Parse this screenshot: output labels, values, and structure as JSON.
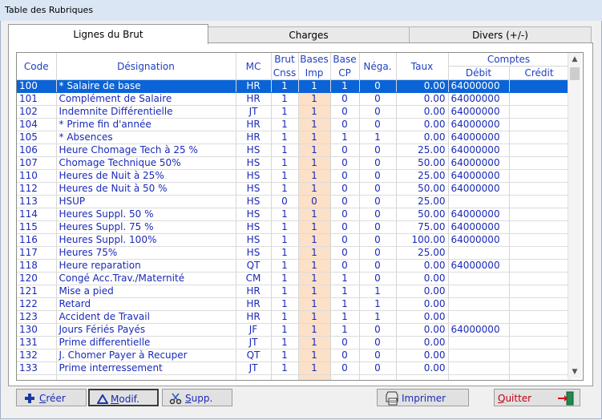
{
  "window": {
    "title": "Table des Rubriques"
  },
  "tabs": [
    {
      "label": "Lignes du Brut",
      "active": true
    },
    {
      "label": "Charges",
      "active": false
    },
    {
      "label": "Divers (+/-)",
      "active": false
    }
  ],
  "grid": {
    "headers": {
      "code": "Code",
      "designation": "Désignation",
      "mc": "MC",
      "brut_top": "Brut",
      "brut_bottom": "Cnss",
      "bases_top": "Bases",
      "bases_bottom": "Imp",
      "base_top": "Base",
      "base_bottom": "CP",
      "nega": "Néga.",
      "taux": "Taux",
      "comptes": "Comptes",
      "debit": "Débit",
      "credit": "Crédit"
    },
    "rows": [
      {
        "code": "100",
        "designation": "* Salaire de base",
        "mc": "HR",
        "brut": "1",
        "imp": "1",
        "cp": "1",
        "nega": "0",
        "taux": "0.00",
        "debit": "64000000",
        "credit": ""
      },
      {
        "code": "101",
        "designation": "Complément de Salaire",
        "mc": "HR",
        "brut": "1",
        "imp": "1",
        "cp": "0",
        "nega": "0",
        "taux": "0.00",
        "debit": "64000000",
        "credit": ""
      },
      {
        "code": "102",
        "designation": "Indemnite Différentielle",
        "mc": "JT",
        "brut": "1",
        "imp": "1",
        "cp": "0",
        "nega": "0",
        "taux": "0.00",
        "debit": "64000000",
        "credit": ""
      },
      {
        "code": "104",
        "designation": "* Prime fin d'année",
        "mc": "HR",
        "brut": "1",
        "imp": "1",
        "cp": "0",
        "nega": "0",
        "taux": "0.00",
        "debit": "64000000",
        "credit": ""
      },
      {
        "code": "105",
        "designation": "* Absences",
        "mc": "HR",
        "brut": "1",
        "imp": "1",
        "cp": "1",
        "nega": "1",
        "taux": "0.00",
        "debit": "64000000",
        "credit": ""
      },
      {
        "code": "106",
        "designation": "Heure Chomage Tech à 25 %",
        "mc": "HS",
        "brut": "1",
        "imp": "1",
        "cp": "0",
        "nega": "0",
        "taux": "25.00",
        "debit": "64000000",
        "credit": ""
      },
      {
        "code": "107",
        "designation": "Chomage Technique 50%",
        "mc": "HS",
        "brut": "1",
        "imp": "1",
        "cp": "0",
        "nega": "0",
        "taux": "50.00",
        "debit": "64000000",
        "credit": ""
      },
      {
        "code": "110",
        "designation": "Heures de Nuit à 25%",
        "mc": "HS",
        "brut": "1",
        "imp": "1",
        "cp": "0",
        "nega": "0",
        "taux": "25.00",
        "debit": "64000000",
        "credit": ""
      },
      {
        "code": "112",
        "designation": "Heures de Nuit à 50 %",
        "mc": "HS",
        "brut": "1",
        "imp": "1",
        "cp": "0",
        "nega": "0",
        "taux": "50.00",
        "debit": "64000000",
        "credit": ""
      },
      {
        "code": "113",
        "designation": "HSUP",
        "mc": "HS",
        "brut": "0",
        "imp": "0",
        "cp": "0",
        "nega": "0",
        "taux": "25.00",
        "debit": "",
        "credit": ""
      },
      {
        "code": "114",
        "designation": "Heures Suppl. 50 %",
        "mc": "HS",
        "brut": "1",
        "imp": "1",
        "cp": "0",
        "nega": "0",
        "taux": "50.00",
        "debit": "64000000",
        "credit": ""
      },
      {
        "code": "115",
        "designation": "Heures Suppl. 75 %",
        "mc": "HS",
        "brut": "1",
        "imp": "1",
        "cp": "0",
        "nega": "0",
        "taux": "75.00",
        "debit": "64000000",
        "credit": ""
      },
      {
        "code": "116",
        "designation": "Heures Suppl. 100%",
        "mc": "HS",
        "brut": "1",
        "imp": "1",
        "cp": "0",
        "nega": "0",
        "taux": "100.00",
        "debit": "64000000",
        "credit": ""
      },
      {
        "code": "117",
        "designation": "Heures 75%",
        "mc": "HS",
        "brut": "1",
        "imp": "1",
        "cp": "0",
        "nega": "0",
        "taux": "25.00",
        "debit": "",
        "credit": ""
      },
      {
        "code": "118",
        "designation": "Heure reparation",
        "mc": "QT",
        "brut": "1",
        "imp": "1",
        "cp": "0",
        "nega": "0",
        "taux": "0.00",
        "debit": "64000000",
        "credit": ""
      },
      {
        "code": "120",
        "designation": "Congé Acc.Trav./Maternité",
        "mc": "CM",
        "brut": "1",
        "imp": "1",
        "cp": "1",
        "nega": "0",
        "taux": "0.00",
        "debit": "",
        "credit": ""
      },
      {
        "code": "121",
        "designation": "Mise a pied",
        "mc": "HR",
        "brut": "1",
        "imp": "1",
        "cp": "1",
        "nega": "1",
        "taux": "0.00",
        "debit": "",
        "credit": ""
      },
      {
        "code": "122",
        "designation": "Retard",
        "mc": "HR",
        "brut": "1",
        "imp": "1",
        "cp": "1",
        "nega": "1",
        "taux": "0.00",
        "debit": "",
        "credit": ""
      },
      {
        "code": "123",
        "designation": "Accident de Travail",
        "mc": "HR",
        "brut": "1",
        "imp": "1",
        "cp": "1",
        "nega": "1",
        "taux": "0.00",
        "debit": "",
        "credit": ""
      },
      {
        "code": "130",
        "designation": "Jours Fériés Payés",
        "mc": "JF",
        "brut": "1",
        "imp": "1",
        "cp": "1",
        "nega": "0",
        "taux": "0.00",
        "debit": "64000000",
        "credit": ""
      },
      {
        "code": "131",
        "designation": "Prime differentielle",
        "mc": "JT",
        "brut": "1",
        "imp": "1",
        "cp": "0",
        "nega": "0",
        "taux": "0.00",
        "debit": "",
        "credit": ""
      },
      {
        "code": "132",
        "designation": "J. Chomer Payer à Recuper",
        "mc": "QT",
        "brut": "1",
        "imp": "1",
        "cp": "0",
        "nega": "0",
        "taux": "0.00",
        "debit": "",
        "credit": ""
      },
      {
        "code": "133",
        "designation": "Prime interressement",
        "mc": "JT",
        "brut": "1",
        "imp": "1",
        "cp": "0",
        "nega": "0",
        "taux": "0.00",
        "debit": "",
        "credit": ""
      },
      {
        "code": "",
        "designation": "",
        "mc": "",
        "brut": "",
        "imp": "",
        "cp": "",
        "nega": "",
        "taux": "",
        "debit": "",
        "credit": ""
      }
    ],
    "selected_index": 0
  },
  "buttons": {
    "creer": {
      "label": "Créer",
      "icon": "plus-icon"
    },
    "modif": {
      "label": "Modif.",
      "icon": "triangle-icon"
    },
    "supp": {
      "label": "Supp.",
      "icon": "scissors-icon"
    },
    "imprimer": {
      "label": "Imprimer",
      "icon": "printer-icon"
    },
    "quitter": {
      "label": "Quitter",
      "icon": "exit-door-icon"
    }
  },
  "colors": {
    "accent_text": "#1a2ab8",
    "selection": "#0a64d8",
    "imp_column": "#fce0c8",
    "quit_text": "#c0000e"
  }
}
